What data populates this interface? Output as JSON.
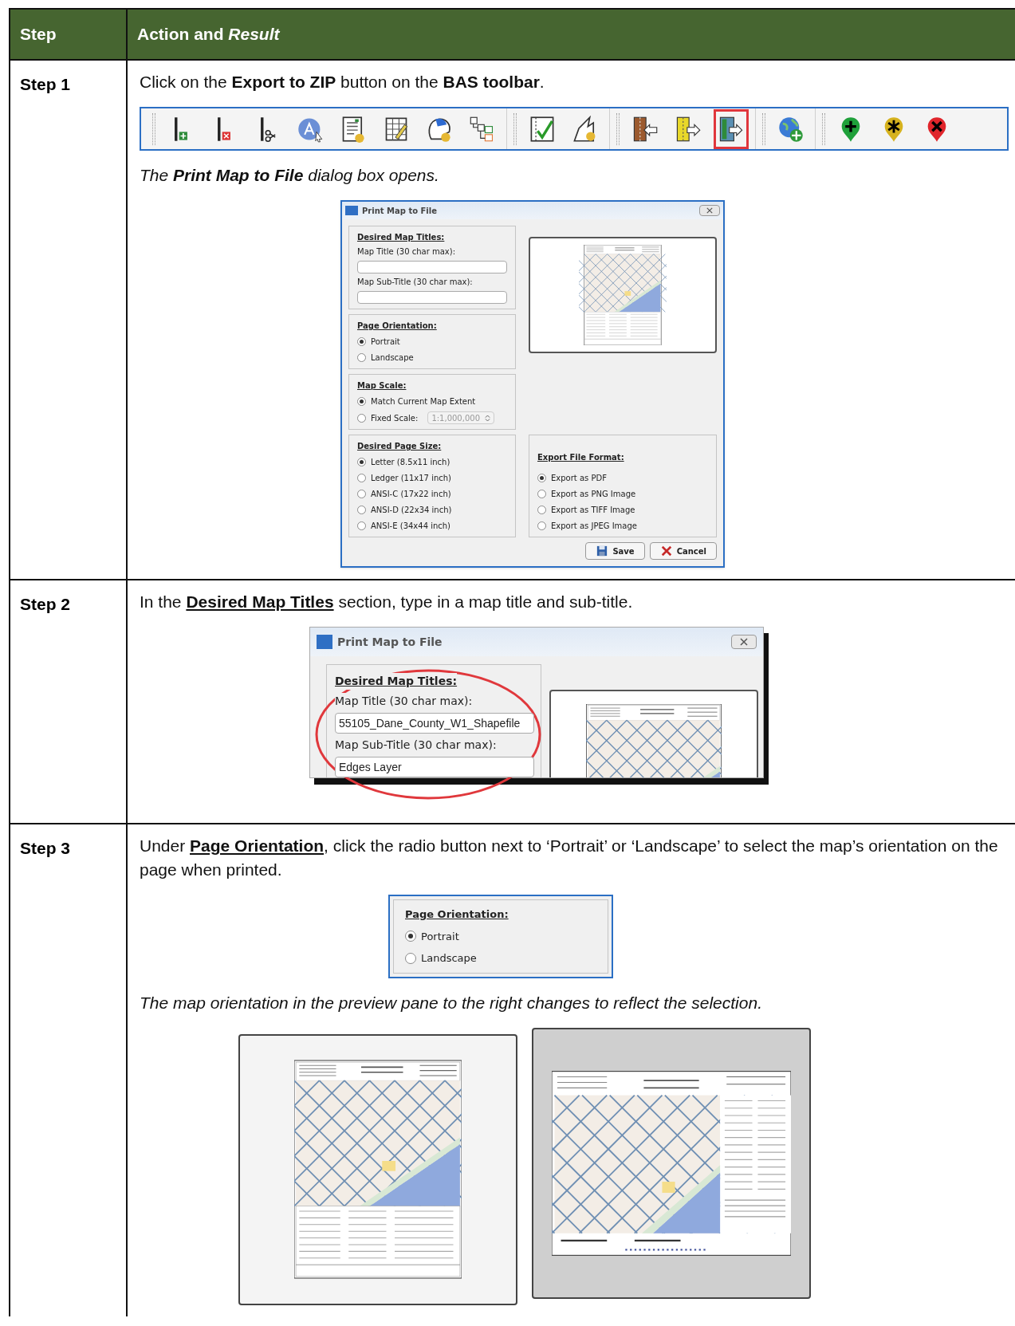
{
  "table": {
    "columns": [
      "Step",
      "Action and *Result*"
    ],
    "rows": [
      {
        "step": "Step 1",
        "items": [
          {
            "kind": "text",
            "underlined": false,
            "text": "Click on the **Export to ZIP** button on the **BAS toolbar**."
          },
          {
            "kind": "toolbar",
            "groups": [
              [
                {
                  "selected": false
                },
                {
                  "selected": false
                },
                {
                  "selected": false
                },
                {
                  "selected": false
                },
                {
                  "selected": false
                },
                {
                  "selected": false
                },
                {
                  "selected": false
                },
                {
                  "selected": false
                }
              ],
              [
                {
                  "selected": false
                },
                {
                  "selected": false
                }
              ],
              [
                {
                  "selected": false
                },
                {
                  "selected": false
                },
                {
                  "selected": true
                }
              ],
              [
                {
                  "selected": false
                }
              ],
              [
                {
                  "selected": false
                },
                {
                  "selected": false
                },
                {
                  "selected": false
                }
              ]
            ]
          },
          {
            "kind": "caption",
            "text": "The **Print Map to File** dialog box opens."
          },
          {
            "kind": "dialog",
            "title": "Print Map to File",
            "titles": {
              "heading": "Desired Map Titles:",
              "fields": [
                {
                  "label": "Map Title (30 char max):"
                },
                {
                  "label": "Map Sub-Title (30 char max):"
                }
              ]
            },
            "orientation": {
              "heading": "Page Orientation:",
              "options": [
                {
                  "label": "Portrait",
                  "selected": true
                },
                {
                  "label": "Landscape",
                  "selected": false
                }
              ]
            },
            "scale": {
              "heading": "Map Scale:",
              "options": [
                {
                  "label": "Match Current Map Extent",
                  "selected": true
                },
                {
                  "label": "Fixed Scale:",
                  "selected": false
                }
              ],
              "spinner": {
                "value": "1:1,000,000",
                "disabled": true
              }
            },
            "page_size": {
              "heading": "Desired Page Size:",
              "options": [
                {
                  "label": "Letter (8.5x11 inch)",
                  "selected": true
                },
                {
                  "label": "Ledger (11x17 inch)",
                  "selected": false
                },
                {
                  "label": "ANSI-C (17x22 inch)",
                  "selected": false
                },
                {
                  "label": "ANSI-D (22x34 inch)",
                  "selected": false
                },
                {
                  "label": "ANSI-E (34x44 inch)",
                  "selected": false
                }
              ]
            },
            "format": {
              "heading": "Export File Format:",
              "options": [
                {
                  "label": "Export as PDF",
                  "selected": true
                },
                {
                  "label": "Export as PNG Image",
                  "selected": false
                },
                {
                  "label": "Export as TIFF Image",
                  "selected": false
                },
                {
                  "label": "Export as JPEG Image",
                  "selected": false
                }
              ]
            },
            "buttons": [
              {
                "label": "Save",
                "kind": "save"
              },
              {
                "label": "Cancel",
                "kind": "cancel"
              }
            ]
          }
        ]
      },
      {
        "step": "Step 2",
        "items": [
          {
            "kind": "text",
            "underlined": true,
            "text": "In the **Desired Map Titles** section, type in a map title and sub-title."
          },
          {
            "kind": "dialog_crop",
            "title": "Print Map to File",
            "heading": "Desired Map Titles:",
            "fields": [
              {
                "label": "Map Title (30 char max):",
                "value": "55105_Dane_County_W1_Shapefile"
              },
              {
                "label": "Map Sub-Title (30 char max):",
                "value": "Edges Layer"
              }
            ]
          }
        ]
      },
      {
        "step": "Step 3",
        "items": [
          {
            "kind": "text",
            "underlined": true,
            "text": "Under **Page Orientation**, click the radio button next to ‘Portrait’ or ‘Landscape’ to select the map’s orientation on the page when printed."
          },
          {
            "kind": "orientation_panel",
            "heading": "Page Orientation:",
            "options": [
              {
                "label": "Portrait",
                "selected": true
              },
              {
                "label": "Landscape",
                "selected": false
              }
            ]
          },
          {
            "kind": "caption",
            "text": "The map orientation in the preview pane to the right changes to reflect the selection."
          },
          {
            "kind": "previews",
            "previews": [
              {
                "kind": "portrait"
              },
              {
                "kind": "landscape"
              }
            ]
          }
        ]
      }
    ]
  }
}
